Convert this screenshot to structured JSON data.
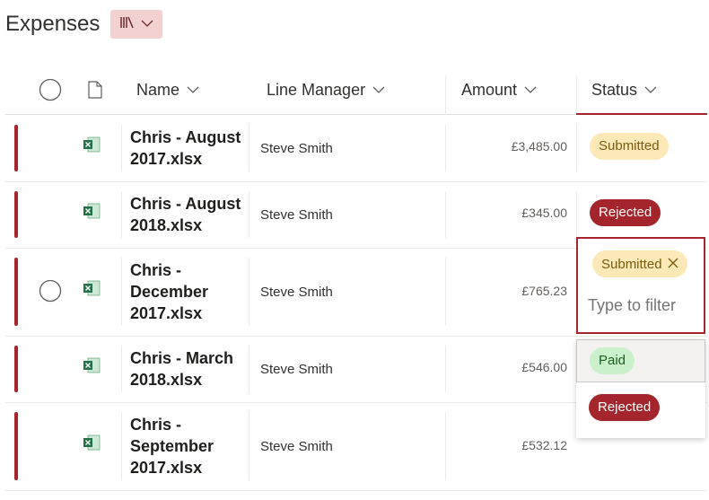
{
  "page": {
    "title": "Expenses"
  },
  "colors": {
    "accent": "#a4262c",
    "submitted_bg": "#fce9b7",
    "paid_bg": "#caf0cc"
  },
  "columns": {
    "name": "Name",
    "line_manager": "Line Manager",
    "amount": "Amount",
    "status": "Status"
  },
  "rows": [
    {
      "name_line1": "Chris - August",
      "name_line2": "2017.xlsx",
      "name_line3": "",
      "manager": "Steve Smith",
      "amount": "£3,485.00",
      "status": "Submitted"
    },
    {
      "name_line1": "Chris - August",
      "name_line2": "2018.xlsx",
      "name_line3": "",
      "manager": "Steve Smith",
      "amount": "£345.00",
      "status": "Rejected"
    },
    {
      "name_line1": "Chris -",
      "name_line2": "December",
      "name_line3": "2017.xlsx",
      "manager": "Steve Smith",
      "amount": "£765.23",
      "status": ""
    },
    {
      "name_line1": "Chris - March",
      "name_line2": "2018.xlsx",
      "name_line3": "",
      "manager": "Steve Smith",
      "amount": "£546.00",
      "status": ""
    },
    {
      "name_line1": "Chris -",
      "name_line2": "September",
      "name_line3": "2017.xlsx",
      "manager": "Steve Smith",
      "amount": "£532.12",
      "status": ""
    }
  ],
  "status_filter": {
    "selected_tag": "Submitted",
    "placeholder": "Type to filter",
    "options": [
      "Paid",
      "Rejected"
    ]
  }
}
